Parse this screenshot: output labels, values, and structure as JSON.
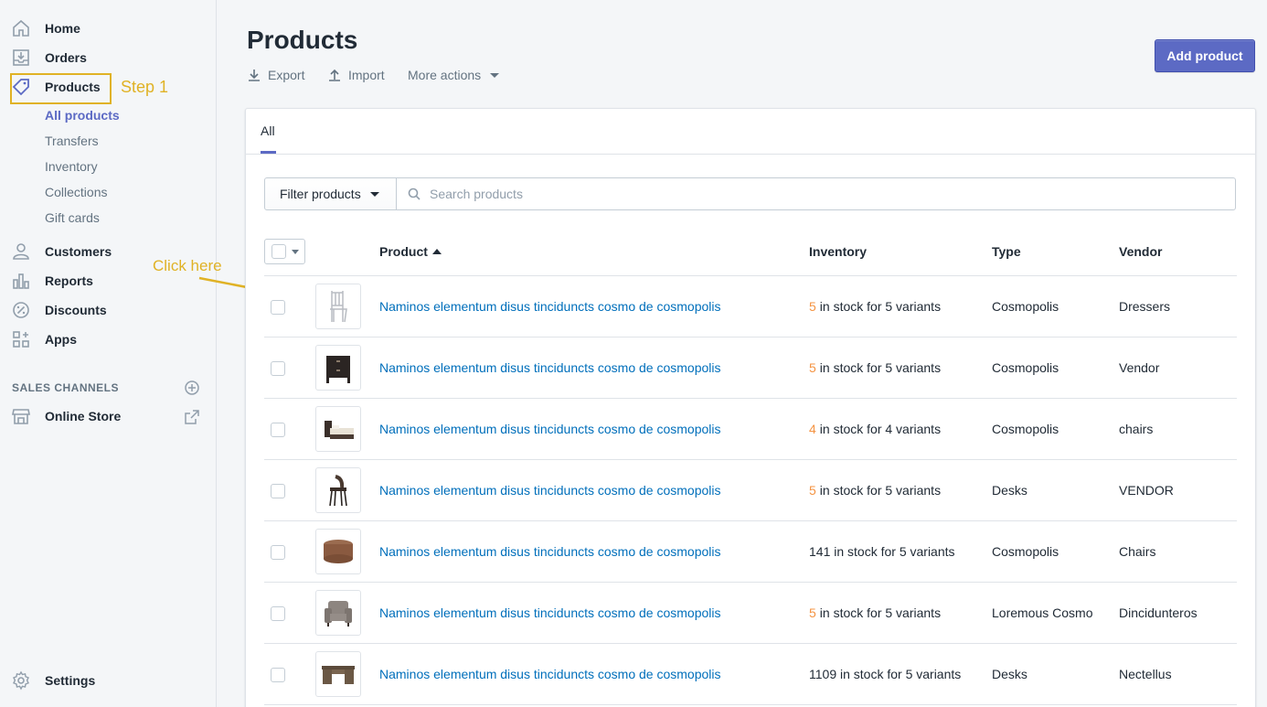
{
  "sidebar": {
    "items": [
      {
        "label": "Home",
        "icon": "home-icon"
      },
      {
        "label": "Orders",
        "icon": "orders-icon"
      },
      {
        "label": "Products",
        "icon": "tag-icon"
      },
      {
        "label": "Customers",
        "icon": "customer-icon"
      },
      {
        "label": "Reports",
        "icon": "reports-icon"
      },
      {
        "label": "Discounts",
        "icon": "discount-icon"
      },
      {
        "label": "Apps",
        "icon": "apps-icon"
      }
    ],
    "product_subitems": [
      "All products",
      "Transfers",
      "Inventory",
      "Collections",
      "Gift cards"
    ],
    "sales_channels_heading": "SALES CHANNELS",
    "online_store": "Online Store",
    "settings": "Settings"
  },
  "annotations": {
    "step": "Step 1",
    "click": "Click here",
    "color": "#e0b225"
  },
  "header": {
    "title": "Products",
    "export": "Export",
    "import": "Import",
    "more_actions": "More actions",
    "add_product": "Add product"
  },
  "tabs": [
    "All"
  ],
  "filter": {
    "button": "Filter products",
    "search_placeholder": "Search products"
  },
  "table": {
    "columns": [
      "Product",
      "Inventory",
      "Type",
      "Vendor"
    ],
    "rows": [
      {
        "name": "Naminos elementum disus tinciduncts cosmo de cosmopolis",
        "inv_count": "5",
        "inv_text": "in stock for 5 variants",
        "type": "Cosmopolis",
        "vendor": "Dressers",
        "thumb": "chair"
      },
      {
        "name": "Naminos elementum disus tinciduncts cosmo de cosmopolis",
        "inv_count": "5",
        "inv_text": "in stock for 5 variants",
        "type": "Cosmopolis",
        "vendor": "Vendor",
        "thumb": "nightstand"
      },
      {
        "name": "Naminos elementum disus tinciduncts cosmo de cosmopolis",
        "inv_count": "4",
        "inv_text": "in stock for 4 variants",
        "type": "Cosmopolis",
        "vendor": "chairs",
        "thumb": "bed"
      },
      {
        "name": "Naminos elementum disus tinciduncts cosmo de cosmopolis",
        "inv_count": "5",
        "inv_text": "in stock for 5 variants",
        "type": "Desks",
        "vendor": "VENDOR",
        "thumb": "stool"
      },
      {
        "name": "Naminos elementum disus tinciduncts cosmo de cosmopolis",
        "inv_count": "",
        "inv_text": "141 in stock for 5 variants",
        "type": "Cosmopolis",
        "vendor": "Chairs",
        "thumb": "ottoman"
      },
      {
        "name": "Naminos elementum disus tinciduncts cosmo de cosmopolis",
        "inv_count": "5",
        "inv_text": "in stock for 5 variants",
        "type": "Loremous Cosmo",
        "vendor": "Dincidunteros",
        "thumb": "armchair"
      },
      {
        "name": "Naminos elementum disus tinciduncts cosmo de cosmopolis",
        "inv_count": "",
        "inv_text": "1109 in stock for 5 variants",
        "type": "Desks",
        "vendor": "Nectellus",
        "thumb": "desk"
      }
    ]
  },
  "colors": {
    "accent": "#5c6ac4",
    "link": "#006fbb",
    "low_stock": "#f49342"
  }
}
